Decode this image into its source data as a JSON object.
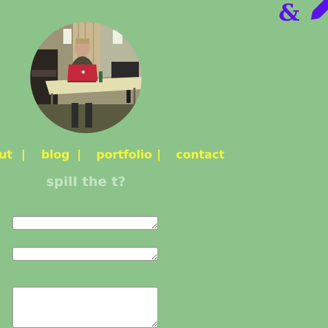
{
  "logo": {
    "icon": "ampersand-pencil-logo-icon",
    "color": "#5a12e6"
  },
  "nav": {
    "items": [
      {
        "label": "ut"
      },
      {
        "label": "blog"
      },
      {
        "label": "portfolio"
      },
      {
        "label": "contact"
      }
    ],
    "separator": "|"
  },
  "form": {
    "title": "spill the t?",
    "field_1": {
      "value": "",
      "placeholder": ""
    },
    "field_2": {
      "value": "",
      "placeholder": ""
    },
    "field_3": {
      "value": "",
      "placeholder": ""
    }
  },
  "colors": {
    "background": "#8cc38b",
    "nav_text": "#f5f53a",
    "title_text": "#c7e4c4"
  }
}
